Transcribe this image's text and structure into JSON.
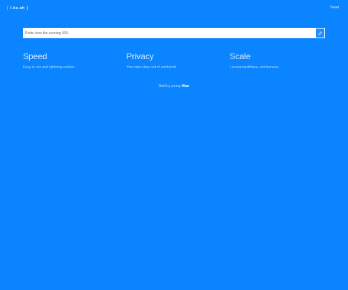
{
  "header": {
    "logo_left_bracket": "[",
    "logo_text": "l.ke.sh",
    "logo_right_bracket": "]",
    "top_link_label": "Tweet"
  },
  "search": {
    "placeholder": "Paste here the cunning URL",
    "button_icon": "link-icon"
  },
  "features": [
    {
      "title": "Speed",
      "description": "Easy to use and lightning sudden."
    },
    {
      "title": "Privacy",
      "description": "Your data stays out of prothands."
    },
    {
      "title": "Scale",
      "description": "Lenasa nestithasu, anirilseneau."
    }
  ],
  "footer": {
    "prefix": "Built by young",
    "link_label": "Alan"
  },
  "colors": {
    "background": "#0A84FF",
    "input_background": "#FFFFFF",
    "text_primary": "#FFFFFF",
    "text_muted": "#B9DBFF"
  }
}
